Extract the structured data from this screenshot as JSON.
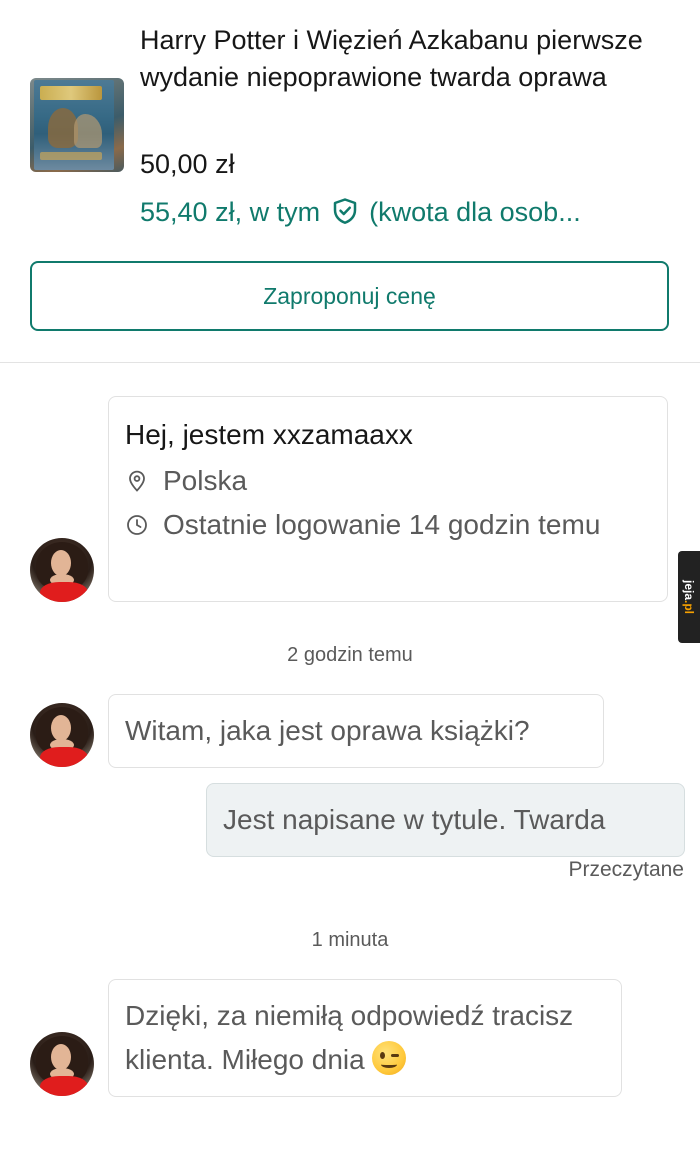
{
  "listing": {
    "title": "Harry Potter i Więzień Azkabanu pierwsze wydanie niepoprawione twarda oprawa",
    "price": "50,00 zł",
    "price_with_protection_prefix": "55,40 zł, w tym",
    "price_with_protection_suffix": "(kwota dla osob...",
    "offer_button_label": "Zaproponuj cenę"
  },
  "profile": {
    "greeting": "Hej, jestem xxzamaaxx",
    "location": "Polska",
    "last_login": "Ostatnie logowanie 14 godzin temu"
  },
  "conversation": {
    "groups": [
      {
        "timestamp": "2 godzin temu",
        "incoming": "Witam, jaka jest oprawa książki?",
        "outgoing": "Jest napisane w tytule. Twarda",
        "status": "Przeczytane"
      },
      {
        "timestamp": "1 minuta",
        "incoming": "Dzięki, za niemiłą odpowiedź tracisz klienta. Miłego dnia"
      }
    ]
  },
  "watermark": {
    "text_main": "jeja",
    "text_suffix": ".pl"
  },
  "colors": {
    "accent": "#107a6c",
    "text_primary": "#171717",
    "text_secondary": "#5a5a5a",
    "border": "#e1e1e1",
    "outgoing_bubble": "#eef2f3",
    "avatar_dress": "#e01d1d"
  },
  "icons": {
    "book_cover": "book-cover-image",
    "buyer_protection": "shield-check-icon",
    "location": "location-pin-icon",
    "last_login": "clock-icon",
    "emoji": "winking-face-emoji"
  }
}
